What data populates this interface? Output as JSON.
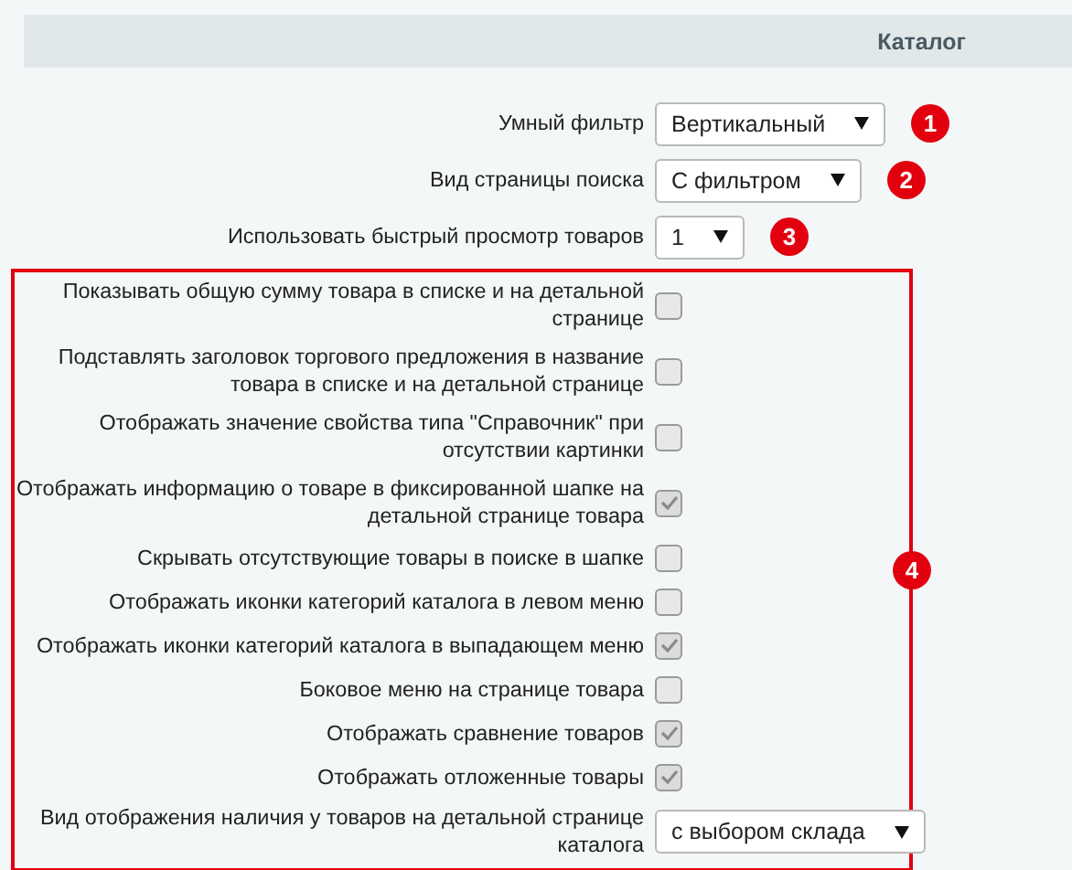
{
  "header": {
    "title": "Каталог"
  },
  "settings": [
    {
      "label": "Умный фильтр",
      "kind": "select",
      "value": "Вертикальный",
      "marker": "1"
    },
    {
      "label": "Вид страницы поиска",
      "kind": "select",
      "value": "С фильтром",
      "marker": "2"
    },
    {
      "label": "Использовать быстрый просмотр товаров",
      "kind": "select",
      "value": "1",
      "marker": "3"
    }
  ],
  "group": {
    "marker": "4",
    "items": [
      {
        "label": "Показывать общую сумму товара в списке и на детальной странице",
        "kind": "checkbox",
        "checked": false
      },
      {
        "label": "Подставлять заголовок торгового предложения в название товара в списке и на детальной странице",
        "kind": "checkbox",
        "checked": false
      },
      {
        "label": "Отображать значение свойства типа \"Справочник\" при отсутствии картинки",
        "kind": "checkbox",
        "checked": false
      },
      {
        "label": "Отображать информацию о товаре в фиксированной шапке на детальной странице товара",
        "kind": "checkbox",
        "checked": true
      },
      {
        "label": "Скрывать отсутствующие товары в поиске в шапке",
        "kind": "checkbox",
        "checked": false
      },
      {
        "label": "Отображать иконки категорий каталога в левом меню",
        "kind": "checkbox",
        "checked": false
      },
      {
        "label": "Отображать иконки категорий каталога в выпадающем меню",
        "kind": "checkbox",
        "checked": true
      },
      {
        "label": "Боковое меню на странице товара",
        "kind": "checkbox",
        "checked": false
      },
      {
        "label": "Отображать сравнение товаров",
        "kind": "checkbox",
        "checked": true
      },
      {
        "label": "Отображать отложенные товары",
        "kind": "checkbox",
        "checked": true
      },
      {
        "label": "Вид отображения наличия у товаров на детальной странице каталога",
        "kind": "select",
        "value": "с выбором склада"
      }
    ]
  }
}
